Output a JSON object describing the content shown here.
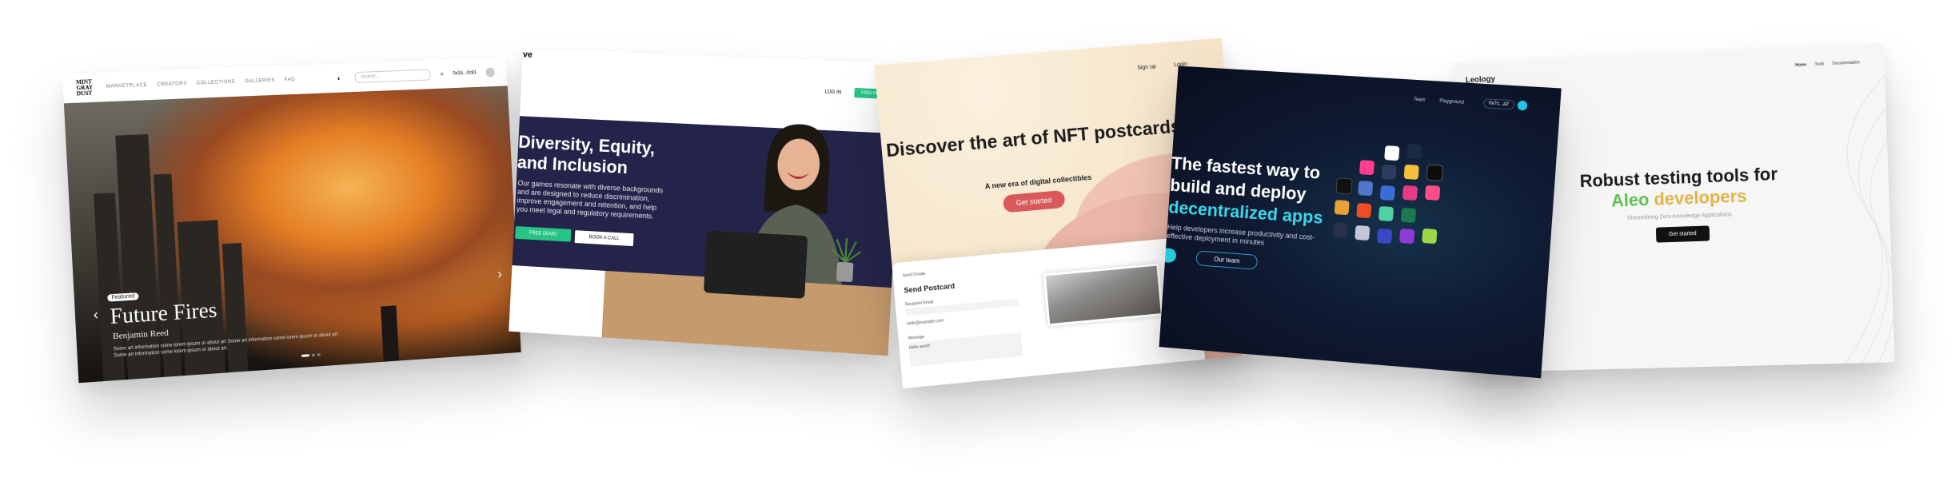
{
  "card1": {
    "logo": "MINT GRAY DUST",
    "nav": [
      "MARKETPLACE",
      "CREATORS",
      "COLLECTIONS",
      "GALLERIES",
      "FAQ"
    ],
    "search_placeholder": "Search...",
    "wallet": "0x1b...0c81",
    "pill": "Featured",
    "title": "Future Fires",
    "author": "Benjamin Reed",
    "description": "Some art information some lorem ipsum or about art Some art information some lorem ipsum or about art Some art information some lorem ipsum or about art.",
    "prev": "‹",
    "next": "›"
  },
  "card2": {
    "logo": "ve",
    "login": "LOG IN",
    "free_demo_top": "FREE DEMO",
    "title": "Diversity, Equity, and Inclusion",
    "body": "Our games resonate with diverse backgrounds and are designed to reduce discrimination, improve engagement and retention, and help you meet legal and regulatory requirements.",
    "free_demo": "FREE DEMO",
    "book_call": "BOOK A CALL"
  },
  "card3": {
    "signup": "Sign up",
    "login": "Login",
    "title": "Discover the art of NFT postcards",
    "subtitle": "A new era of digital collectibles",
    "cta": "Get started",
    "form_title": "Send Postcard",
    "breadcrumb": "Send Create",
    "labels": [
      "Recipient Email",
      "Message"
    ],
    "values": [
      "hello@example.com",
      "Hello world!"
    ]
  },
  "card4": {
    "nav": [
      "Team",
      "Playground"
    ],
    "wallet": "0x7c...a2",
    "title_1": "The fastest way to",
    "title_2": "build and deploy",
    "title_accent": "decentralized apps",
    "body": "Help developers increase productivity and cost-effective deployment in minutes",
    "cta_secondary": "Our team"
  },
  "card5": {
    "logo": "Leology",
    "nav": [
      "Home",
      "Tools",
      "Documentation"
    ],
    "title_1": "Robust testing tools for",
    "title_green": "Aleo",
    "title_orange": "developers",
    "subtitle": "Streamlining Zero Knowledge Applications",
    "cta": "Get started"
  },
  "colors": {
    "accent_green": "#27c486",
    "accent_coral": "#d9595b",
    "accent_cyan": "#3ad8ea",
    "aleo_green": "#5ec152",
    "aleo_orange": "#e3b344"
  }
}
